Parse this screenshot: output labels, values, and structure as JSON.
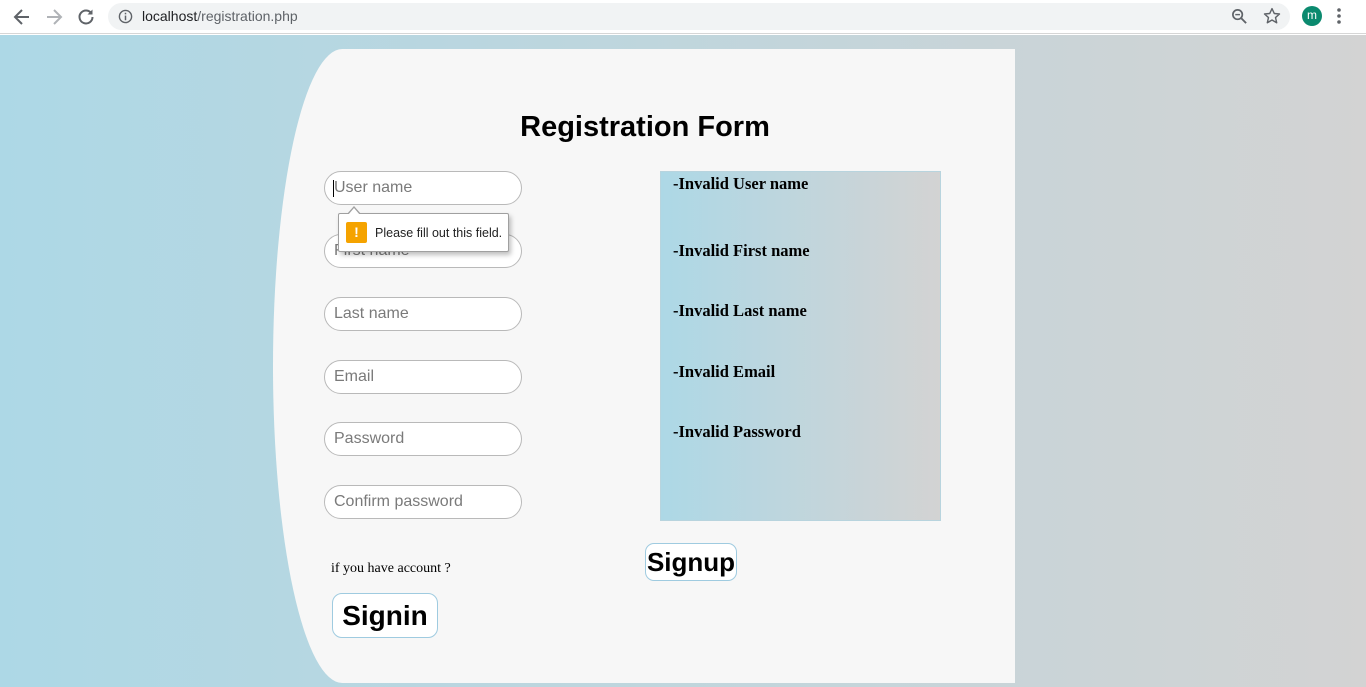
{
  "browser": {
    "url_host": "localhost",
    "url_path": "/registration.php",
    "avatar_initial": "m",
    "avatar_color": "#0b8a6f"
  },
  "icons": {
    "back": "arrow-left",
    "forward": "arrow-right",
    "reload": "reload",
    "info": "info-circle",
    "zoom": "magnifier",
    "bookmark": "star",
    "menu": "three-dots-vertical",
    "warning": "exclamation"
  },
  "form": {
    "title": "Registration Form",
    "fields": {
      "username": {
        "placeholder": "User name",
        "value": ""
      },
      "firstname": {
        "placeholder": "First name",
        "value": ""
      },
      "lastname": {
        "placeholder": "Last name",
        "value": ""
      },
      "email": {
        "placeholder": "Email",
        "value": ""
      },
      "password": {
        "placeholder": "Password",
        "value": ""
      },
      "confirm": {
        "placeholder": "Confirm password",
        "value": ""
      }
    },
    "validation_tooltip": "Please fill out this field.",
    "errors": [
      "-Invalid User name",
      "-Invalid First name",
      "-Invalid Last name",
      "-Invalid Email",
      "-Invalid Password"
    ],
    "signup_label": "Signup",
    "account_prompt": "if you have account ?",
    "signin_label": "Signin"
  },
  "colors": {
    "gradient_start": "#add8e6",
    "gradient_end": "#d3d3d3",
    "panel": "#f7f7f7",
    "warning": "#f5a300"
  }
}
